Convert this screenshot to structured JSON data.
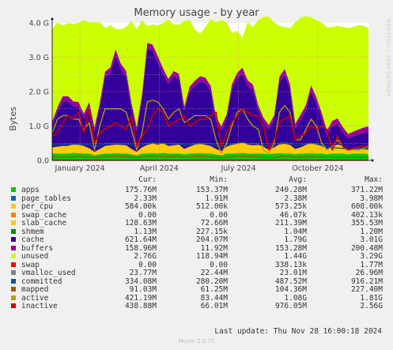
{
  "title": "Memory usage - by year",
  "vertical_brand": "RRDTOOL / TOBI OETIKER",
  "footer_brand": "Munin 2.0.75",
  "last_update": "Last update: Thu Nov 28 16:00:18 2024",
  "legend_headers": {
    "cur": "Cur:",
    "min": "Min:",
    "avg": "Avg:",
    "max": "Max:"
  },
  "legend": [
    {
      "name": "apps",
      "color": "#00cc00",
      "cur": "175.76M",
      "min": "153.37M",
      "avg": "240.28M",
      "max": "371.22M"
    },
    {
      "name": "page_tables",
      "color": "#0066b3",
      "cur": "2.33M",
      "min": "1.91M",
      "avg": "2.38M",
      "max": "3.98M"
    },
    {
      "name": "per_cpu",
      "color": "#ffcc00",
      "cur": "584.00k",
      "min": "512.00k",
      "avg": "573.25k",
      "max": "608.00k"
    },
    {
      "name": "swap_cache",
      "color": "#ff8000",
      "cur": "0.00",
      "min": "0.00",
      "avg": "46.07k",
      "max": "402.13k"
    },
    {
      "name": "slab_cache",
      "color": "#ffcc00",
      "cur": "128.63M",
      "min": "72.66M",
      "avg": "211.39M",
      "max": "355.53M"
    },
    {
      "name": "shmem",
      "color": "#008f00",
      "cur": "1.13M",
      "min": "227.15k",
      "avg": "1.04M",
      "max": "1.20M"
    },
    {
      "name": "cache",
      "color": "#330099",
      "cur": "621.64M",
      "min": "204.07M",
      "avg": "1.79G",
      "max": "3.01G"
    },
    {
      "name": "buffers",
      "color": "#990099",
      "cur": "158.96M",
      "min": "11.92M",
      "avg": "153.28M",
      "max": "200.48M"
    },
    {
      "name": "unused",
      "color": "#ccff00",
      "cur": "2.76G",
      "min": "118.94M",
      "avg": "1.44G",
      "max": "3.29G"
    },
    {
      "name": "swap",
      "color": "#ff0000",
      "cur": "0.00",
      "min": "0.00",
      "avg": "338.13k",
      "max": "1.77M"
    },
    {
      "name": "vmalloc_used",
      "color": "#808080",
      "cur": "23.77M",
      "min": "22.44M",
      "avg": "23.01M",
      "max": "26.96M"
    },
    {
      "name": "committed",
      "color": "#005a8c",
      "cur": "334.08M",
      "min": "280.20M",
      "avg": "487.52M",
      "max": "916.21M"
    },
    {
      "name": "mapped",
      "color": "#a35600",
      "cur": "91.03M",
      "min": "61.25M",
      "avg": "104.36M",
      "max": "227.40M"
    },
    {
      "name": "active",
      "color": "#b3a200",
      "cur": "421.19M",
      "min": "83.44M",
      "avg": "1.08G",
      "max": "1.81G"
    },
    {
      "name": "inactive",
      "color": "#cc0000",
      "cur": "438.88M",
      "min": "66.01M",
      "avg": "976.05M",
      "max": "2.56G"
    }
  ],
  "chart_data": {
    "type": "area",
    "title": "Memory usage - by year",
    "ylabel": "Bytes",
    "ylim": [
      0,
      4.0
    ],
    "y_unit": "G",
    "y_ticks": [
      "0.0",
      "1.0 G",
      "2.0 G",
      "3.0 G",
      "4.0 G"
    ],
    "x_tick_labels": [
      "January 2024",
      "April 2024",
      "July 2024",
      "October 2024"
    ],
    "x_ticks_month": [
      1.0,
      4.0,
      7.0,
      10.0
    ],
    "xlim_month": [
      -0.05,
      11.92
    ],
    "grid": true,
    "x_month": [
      -0.05,
      0.15,
      0.35,
      0.55,
      0.75,
      0.95,
      1.15,
      1.35,
      1.55,
      1.75,
      1.95,
      2.15,
      2.35,
      2.55,
      2.75,
      2.95,
      3.15,
      3.35,
      3.55,
      3.75,
      3.95,
      4.15,
      4.35,
      4.55,
      4.75,
      4.95,
      5.15,
      5.35,
      5.55,
      5.75,
      5.95,
      6.15,
      6.35,
      6.55,
      6.75,
      6.95,
      7.15,
      7.35,
      7.55,
      7.75,
      7.95,
      8.15,
      8.35,
      8.55,
      8.75,
      8.95,
      9.15,
      9.35,
      9.55,
      9.75,
      9.95,
      10.15,
      10.35,
      10.55,
      10.75,
      10.95,
      11.15,
      11.35,
      11.55,
      11.75,
      11.92
    ],
    "series": [
      {
        "name": "apps",
        "values": [
          0.2,
          0.2,
          0.2,
          0.2,
          0.22,
          0.21,
          0.2,
          0.2,
          0.15,
          0.18,
          0.2,
          0.2,
          0.21,
          0.2,
          0.2,
          0.18,
          0.15,
          0.2,
          0.2,
          0.21,
          0.2,
          0.22,
          0.2,
          0.2,
          0.2,
          0.18,
          0.2,
          0.2,
          0.21,
          0.2,
          0.2,
          0.18,
          0.15,
          0.2,
          0.2,
          0.2,
          0.22,
          0.2,
          0.2,
          0.2,
          0.2,
          0.18,
          0.2,
          0.21,
          0.2,
          0.2,
          0.18,
          0.2,
          0.2,
          0.21,
          0.2,
          0.2,
          0.18,
          0.2,
          0.2,
          0.2,
          0.18,
          0.2,
          0.2,
          0.2,
          0.18
        ]
      },
      {
        "name": "slab_cache",
        "values": [
          0.18,
          0.2,
          0.22,
          0.22,
          0.25,
          0.24,
          0.22,
          0.15,
          0.1,
          0.15,
          0.22,
          0.24,
          0.25,
          0.25,
          0.24,
          0.15,
          0.1,
          0.18,
          0.25,
          0.28,
          0.26,
          0.28,
          0.22,
          0.24,
          0.26,
          0.15,
          0.2,
          0.26,
          0.28,
          0.25,
          0.22,
          0.15,
          0.12,
          0.2,
          0.25,
          0.28,
          0.3,
          0.26,
          0.24,
          0.25,
          0.2,
          0.12,
          0.18,
          0.26,
          0.28,
          0.25,
          0.15,
          0.18,
          0.25,
          0.3,
          0.26,
          0.22,
          0.15,
          0.2,
          0.26,
          0.22,
          0.15,
          0.15,
          0.15,
          0.15,
          0.15
        ]
      },
      {
        "name": "cache",
        "values": [
          0.6,
          1.0,
          1.3,
          1.3,
          1.1,
          1.1,
          0.8,
          1.2,
          0.6,
          1.2,
          2.0,
          2.1,
          2.6,
          2.2,
          2.0,
          1.2,
          0.6,
          1.4,
          2.8,
          2.7,
          2.4,
          2.0,
          1.8,
          2.0,
          1.9,
          1.1,
          1.6,
          1.7,
          1.8,
          1.8,
          1.6,
          0.8,
          0.6,
          0.8,
          1.6,
          1.9,
          2.0,
          1.7,
          1.6,
          1.0,
          0.7,
          0.6,
          0.8,
          1.8,
          2.0,
          1.6,
          0.6,
          0.8,
          1.0,
          1.5,
          1.2,
          0.8,
          0.4,
          0.6,
          0.6,
          0.4,
          0.3,
          0.35,
          0.4,
          0.45,
          0.5
        ]
      },
      {
        "name": "buffers",
        "values": [
          0.15,
          0.15,
          0.15,
          0.15,
          0.15,
          0.15,
          0.14,
          0.15,
          0.12,
          0.15,
          0.16,
          0.16,
          0.17,
          0.16,
          0.16,
          0.14,
          0.12,
          0.15,
          0.17,
          0.18,
          0.17,
          0.17,
          0.15,
          0.16,
          0.16,
          0.14,
          0.15,
          0.16,
          0.16,
          0.16,
          0.15,
          0.14,
          0.13,
          0.14,
          0.16,
          0.17,
          0.18,
          0.17,
          0.16,
          0.15,
          0.14,
          0.13,
          0.14,
          0.17,
          0.18,
          0.16,
          0.14,
          0.15,
          0.16,
          0.18,
          0.17,
          0.16,
          0.14,
          0.15,
          0.16,
          0.15,
          0.14,
          0.14,
          0.15,
          0.16,
          0.16
        ]
      },
      {
        "name": "unused",
        "values": [
          2.69,
          2.47,
          2.05,
          2.13,
          2.25,
          2.3,
          2.72,
          2.32,
          3.05,
          2.34,
          1.27,
          1.23,
          0.59,
          1.0,
          1.29,
          2.38,
          2.85,
          2.15,
          0.48,
          0.59,
          0.89,
          1.33,
          1.73,
          1.35,
          1.43,
          2.49,
          1.94,
          1.48,
          1.24,
          1.47,
          1.94,
          2.75,
          3.08,
          2.68,
          1.49,
          1.22,
          0.87,
          1.69,
          1.68,
          2.49,
          2.94,
          3.15,
          2.7,
          1.47,
          1.22,
          1.63,
          2.95,
          2.82,
          2.59,
          1.97,
          2.25,
          2.63,
          3.0,
          2.73,
          2.69,
          2.91,
          3.08,
          3.05,
          3.04,
          2.95,
          2.86
        ]
      },
      {
        "name": "active",
        "values": [
          0.8,
          1.2,
          1.3,
          1.3,
          1.2,
          1.2,
          0.9,
          1.1,
          0.3,
          1.0,
          1.5,
          1.5,
          1.5,
          1.5,
          1.4,
          0.9,
          0.3,
          0.8,
          1.7,
          1.75,
          1.7,
          1.5,
          1.2,
          1.4,
          1.5,
          1.1,
          1.2,
          1.3,
          1.3,
          1.3,
          1.2,
          0.6,
          0.2,
          0.5,
          1.0,
          1.4,
          1.5,
          1.2,
          1.0,
          0.9,
          0.3,
          0.2,
          0.5,
          1.4,
          1.6,
          1.4,
          0.6,
          0.6,
          0.9,
          1.2,
          1.0,
          0.5,
          0.3,
          0.4,
          0.6,
          0.4,
          0.3,
          0.3,
          0.3,
          0.35,
          0.4
        ]
      },
      {
        "name": "inactive",
        "values": [
          0.7,
          0.8,
          1.1,
          1.3,
          1.2,
          1.4,
          0.8,
          1.5,
          0.5,
          0.8,
          0.9,
          1.0,
          1.1,
          1.0,
          0.9,
          1.3,
          0.4,
          0.7,
          0.9,
          1.3,
          1.5,
          1.4,
          1.0,
          1.1,
          1.2,
          1.3,
          1.0,
          1.1,
          1.2,
          1.2,
          1.3,
          1.4,
          0.4,
          0.8,
          1.1,
          1.3,
          1.5,
          1.4,
          1.3,
          1.3,
          1.0,
          0.3,
          0.6,
          1.1,
          1.2,
          1.3,
          0.6,
          0.7,
          0.8,
          1.0,
          0.9,
          1.0,
          0.9,
          0.3,
          0.7,
          0.4,
          0.3,
          0.35,
          0.4,
          0.4,
          0.45
        ]
      },
      {
        "name": "committed",
        "values": [
          0.45,
          0.45,
          0.46,
          0.46,
          0.47,
          0.47,
          0.46,
          0.46,
          0.4,
          0.44,
          0.48,
          0.48,
          0.5,
          0.49,
          0.48,
          0.45,
          0.4,
          0.45,
          0.5,
          0.52,
          0.5,
          0.5,
          0.48,
          0.48,
          0.49,
          0.44,
          0.46,
          0.48,
          0.49,
          0.49,
          0.48,
          0.44,
          0.4,
          0.44,
          0.48,
          0.5,
          0.52,
          0.5,
          0.49,
          0.48,
          0.44,
          0.4,
          0.44,
          0.5,
          0.52,
          0.5,
          0.44,
          0.45,
          0.48,
          0.5,
          0.48,
          0.46,
          0.4,
          0.38,
          0.36,
          0.35,
          0.33,
          0.33,
          0.33,
          0.33,
          0.33
        ]
      },
      {
        "name": "mapped",
        "values": [
          0.1,
          0.1,
          0.1,
          0.1,
          0.1,
          0.11,
          0.1,
          0.1,
          0.08,
          0.1,
          0.11,
          0.11,
          0.12,
          0.11,
          0.11,
          0.1,
          0.08,
          0.1,
          0.12,
          0.12,
          0.12,
          0.11,
          0.1,
          0.11,
          0.11,
          0.1,
          0.1,
          0.11,
          0.11,
          0.11,
          0.1,
          0.09,
          0.08,
          0.09,
          0.11,
          0.12,
          0.12,
          0.11,
          0.11,
          0.1,
          0.09,
          0.08,
          0.09,
          0.11,
          0.12,
          0.11,
          0.09,
          0.1,
          0.1,
          0.11,
          0.1,
          0.1,
          0.09,
          0.09,
          0.09,
          0.09,
          0.09,
          0.09,
          0.09,
          0.09,
          0.09
        ]
      },
      {
        "name": "swap",
        "values": [
          0,
          0,
          0,
          0,
          0,
          0,
          0,
          0,
          0,
          0,
          0,
          0,
          0,
          0,
          0,
          0,
          0,
          0,
          0,
          0,
          0,
          0,
          0,
          0,
          0,
          0,
          0,
          0,
          0,
          0,
          0,
          0,
          0,
          0,
          0,
          0,
          0,
          0,
          0,
          0,
          0,
          0,
          0,
          0,
          0,
          0,
          0,
          0,
          0,
          0,
          0,
          0,
          0,
          0,
          0,
          0,
          0,
          0,
          0,
          0,
          0
        ]
      }
    ]
  }
}
